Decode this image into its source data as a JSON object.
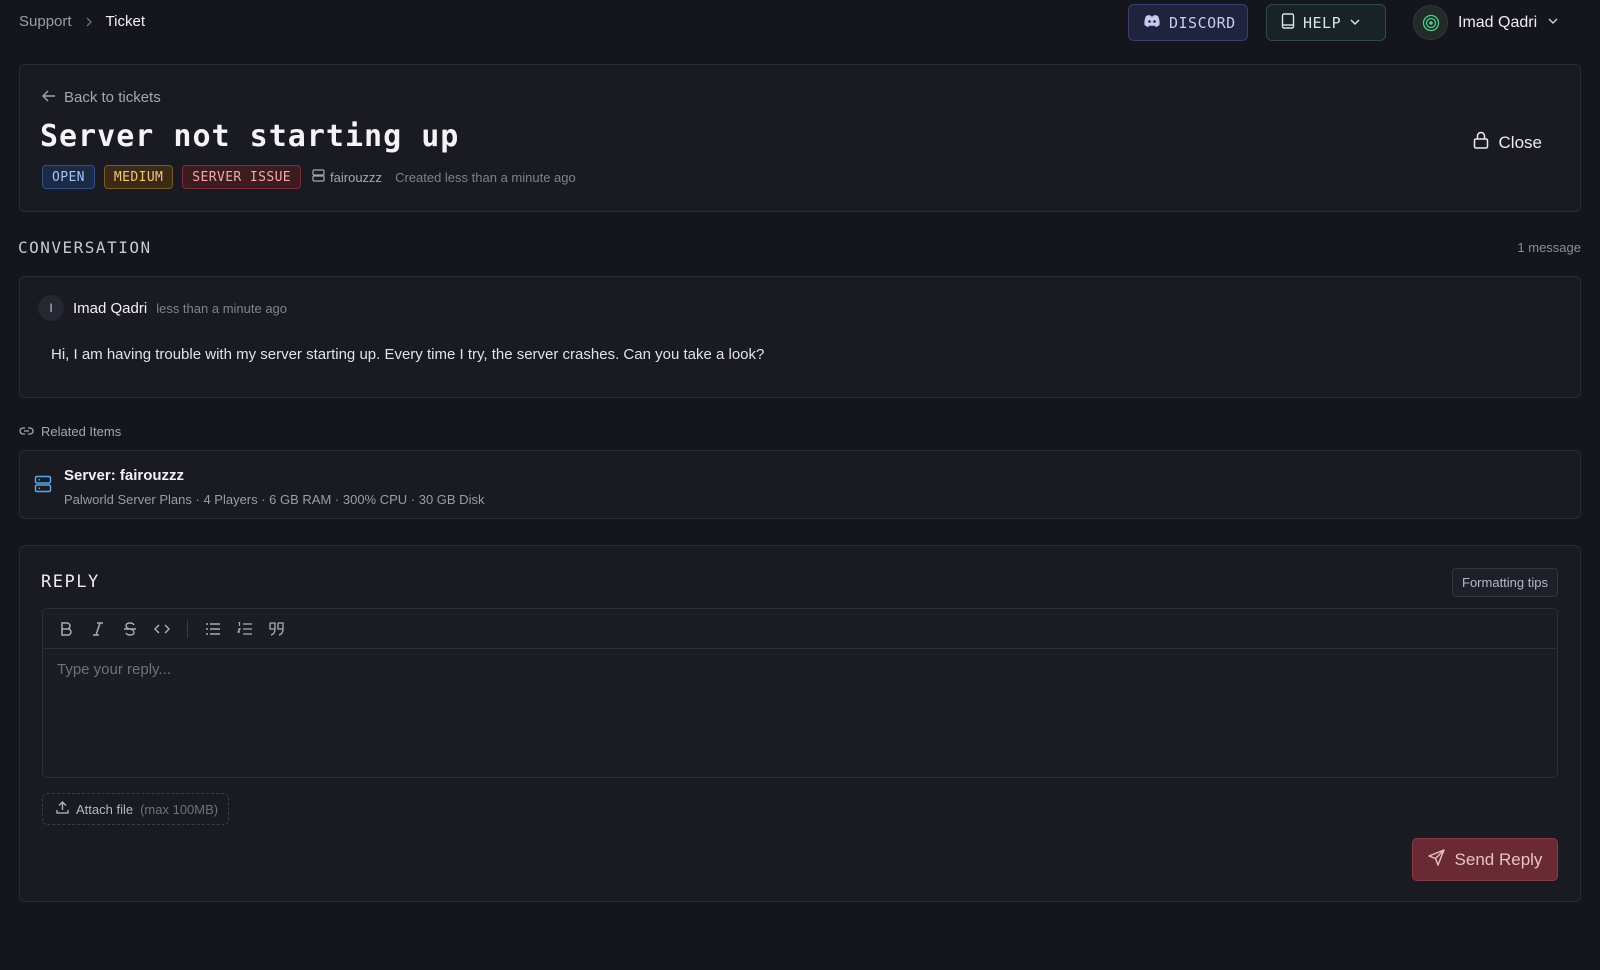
{
  "breadcrumb": {
    "parent": "Support",
    "current": "Ticket"
  },
  "header": {
    "discord_label": "DISCORD",
    "help_label": "HELP",
    "user_name": "Imad Qadri"
  },
  "ticket": {
    "back_label": "Back to tickets",
    "title": "Server not starting up",
    "status": "OPEN",
    "priority": "MEDIUM",
    "category": "SERVER ISSUE",
    "server_name": "fairouzzz",
    "created": "Created less than a minute ago",
    "close_label": "Close"
  },
  "conversation": {
    "title": "CONVERSATION",
    "count": "1 message",
    "messages": [
      {
        "avatar_initial": "I",
        "author": "Imad Qadri",
        "time": "less than a minute ago",
        "body": "Hi, I am having trouble with my server starting up. Every time I try, the server crashes. Can you take a look?"
      }
    ]
  },
  "related": {
    "label": "Related Items",
    "items": [
      {
        "title": "Server: fairouzzz",
        "details": "Palworld Server Plans · 4 Players · 6 GB RAM · 300% CPU · 30 GB Disk"
      }
    ]
  },
  "reply": {
    "title": "REPLY",
    "tips_label": "Formatting tips",
    "placeholder": "Type your reply...",
    "toolbar_icons": [
      "bold-icon",
      "italic-icon",
      "strikethrough-icon",
      "code-icon",
      "bullet-list-icon",
      "numbered-list-icon",
      "quote-icon"
    ],
    "attach_label": "Attach file",
    "attach_hint": "(max 100MB)",
    "send_label": "Send Reply"
  },
  "colors": {
    "background": "#15161d",
    "card": "#191a22",
    "status_open": "#a9c4f5",
    "priority_medium": "#f0c77a",
    "category_issue": "#f1a9ae",
    "send_button": "#6a2a35"
  }
}
